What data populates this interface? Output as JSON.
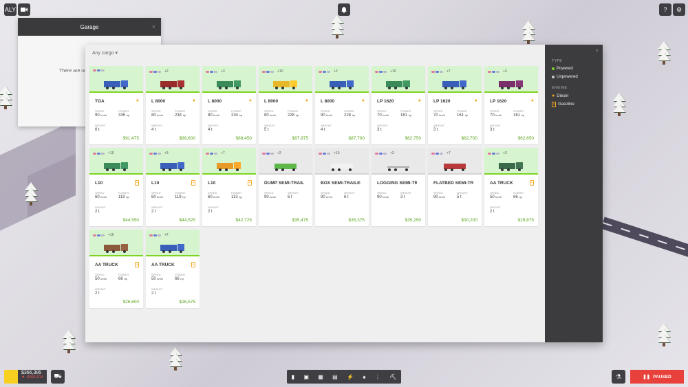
{
  "topbar": {
    "ally_label": "ALY",
    "camera_icon": "video-camera-icon",
    "notification_icon": "bell-icon",
    "help_icon": "question-icon",
    "settings_icon": "gear-icon"
  },
  "garage": {
    "title": "Garage",
    "close": "×",
    "message": "There are no"
  },
  "catalog": {
    "filter_label": "Any cargo ▾",
    "close": "×"
  },
  "filters": {
    "type_heading": "TYPE",
    "type_options": [
      "Powered",
      "Unpowered"
    ],
    "engine_heading": "ENGINE",
    "engine_options": [
      "Diesel",
      "Gasoline"
    ],
    "colors": {
      "powered": "#7ed321",
      "unpowered": "#cccccc",
      "diesel": "#f5a623"
    }
  },
  "labels": {
    "speed": "SPEED",
    "power": "POWER",
    "weight": "WEIGHT"
  },
  "vehicles": [
    {
      "name": "TGA",
      "more": "",
      "engine": "diesel",
      "speed": "90",
      "speed_unit": "km/h",
      "power": "335",
      "power_unit": "hp",
      "weight": "6 t",
      "price": "$91,475",
      "powered": true,
      "color": "#3a5fb8"
    },
    {
      "name": "L 8000",
      "more": "+2",
      "engine": "diesel",
      "speed": "80",
      "speed_unit": "km/h",
      "power": "234",
      "power_unit": "hp",
      "weight": "4 t",
      "price": "$89,600",
      "powered": true,
      "color": "#9b2c2c"
    },
    {
      "name": "L 8000",
      "more": "+3",
      "engine": "diesel",
      "speed": "80",
      "speed_unit": "km/h",
      "power": "234",
      "power_unit": "hp",
      "weight": "4 t",
      "price": "$89,450",
      "powered": true,
      "color": "#3b8a5a"
    },
    {
      "name": "L 8000",
      "more": "+10",
      "engine": "diesel",
      "speed": "80",
      "speed_unit": "km/h",
      "power": "228",
      "power_unit": "hp",
      "weight": "5 t",
      "price": "$87,975",
      "powered": true,
      "color": "#e8b828"
    },
    {
      "name": "L 8000",
      "more": "+2",
      "engine": "diesel",
      "speed": "90",
      "speed_unit": "km/h",
      "power": "228",
      "power_unit": "hp",
      "weight": "4 t",
      "price": "$87,700",
      "powered": true,
      "color": "#3a5fb8"
    },
    {
      "name": "LP 1620",
      "more": "+10",
      "engine": "diesel",
      "speed": "70",
      "speed_unit": "km/h",
      "power": "161",
      "power_unit": "hp",
      "weight": "3 t",
      "price": "$62,750",
      "powered": true,
      "color": "#3b8a5a"
    },
    {
      "name": "LP 1620",
      "more": "+7",
      "engine": "diesel",
      "speed": "70",
      "speed_unit": "km/h",
      "power": "161",
      "power_unit": "hp",
      "weight": "3 t",
      "price": "$62,700",
      "powered": true,
      "color": "#3a5fb8"
    },
    {
      "name": "LP 1620",
      "more": "+3",
      "engine": "diesel",
      "speed": "70",
      "speed_unit": "km/h",
      "power": "161",
      "power_unit": "hp",
      "weight": "3 t",
      "price": "$62,650",
      "powered": true,
      "color": "#7a2f6b"
    },
    {
      "name": "L10",
      "more": "+10",
      "engine": "gasoline",
      "speed": "60",
      "speed_unit": "km/h",
      "power": "119",
      "power_unit": "hp",
      "weight": "2 t",
      "price": "$44,550",
      "powered": true,
      "color": "#3b8a5a"
    },
    {
      "name": "L10",
      "more": "+3",
      "engine": "gasoline",
      "speed": "60",
      "speed_unit": "km/h",
      "power": "119",
      "power_unit": "hp",
      "weight": "2 t",
      "price": "$44,525",
      "powered": true,
      "color": "#3a5fb8"
    },
    {
      "name": "L10",
      "more": "+7",
      "engine": "gasoline",
      "speed": "60",
      "speed_unit": "km/h",
      "power": "113",
      "power_unit": "hp",
      "weight": "2 t",
      "price": "$42,725",
      "powered": true,
      "color": "#e89a28"
    },
    {
      "name": "DUMP SEMI-TRAILER",
      "more": "+2",
      "engine": "",
      "speed": "90",
      "speed_unit": "km/h",
      "power": "",
      "power_unit": "",
      "weight": "6 t",
      "price": "$35,475",
      "powered": false,
      "color": "#5fb84a"
    },
    {
      "name": "BOX SEMI-TRAILER",
      "more": "+10",
      "engine": "",
      "speed": "90",
      "speed_unit": "km/h",
      "power": "",
      "power_unit": "",
      "weight": "6 t",
      "price": "$35,375",
      "powered": false,
      "color": "#f2f2f2"
    },
    {
      "name": "LOGGING SEMI-TRAILER",
      "more": "+3",
      "engine": "",
      "speed": "90",
      "speed_unit": "km/h",
      "power": "",
      "power_unit": "",
      "weight": "3 t",
      "price": "$35,250",
      "powered": false,
      "color": "#aaaaaa"
    },
    {
      "name": "FLATBED SEMI-TRAILER",
      "more": "+7",
      "engine": "",
      "speed": "90",
      "speed_unit": "km/h",
      "power": "",
      "power_unit": "",
      "weight": "5 t",
      "price": "$30,200",
      "powered": false,
      "color": "#b83a3a"
    },
    {
      "name": "AA TRUCK",
      "more": "+3",
      "engine": "gasoline",
      "speed": "50",
      "speed_unit": "km/h",
      "power": "66",
      "power_unit": "hp",
      "weight": "2 t",
      "price": "$29,875",
      "powered": true,
      "color": "#3b6a4a"
    },
    {
      "name": "AA TRUCK",
      "more": "+10",
      "engine": "gasoline",
      "speed": "50",
      "speed_unit": "km/h",
      "power": "66",
      "power_unit": "hp",
      "weight": "2 t",
      "price": "$26,600",
      "powered": true,
      "color": "#8a5a3a"
    },
    {
      "name": "AA TRUCK",
      "more": "+7",
      "engine": "gasoline",
      "speed": "50",
      "speed_unit": "km/h",
      "power": "66",
      "power_unit": "hp",
      "weight": "2 t",
      "price": "$26,575",
      "powered": true,
      "color": "#3a5fb8"
    }
  ],
  "cargo_colors": [
    "#e07a9a",
    "#6a7ad8",
    "#b8b8c8",
    "#333333",
    "#c86a4a"
  ],
  "bottombar": {
    "cash": "$366,385",
    "delta": "▼ -$365,614",
    "paused_label": "PAUSED",
    "pause_icon": "pause-icon"
  }
}
